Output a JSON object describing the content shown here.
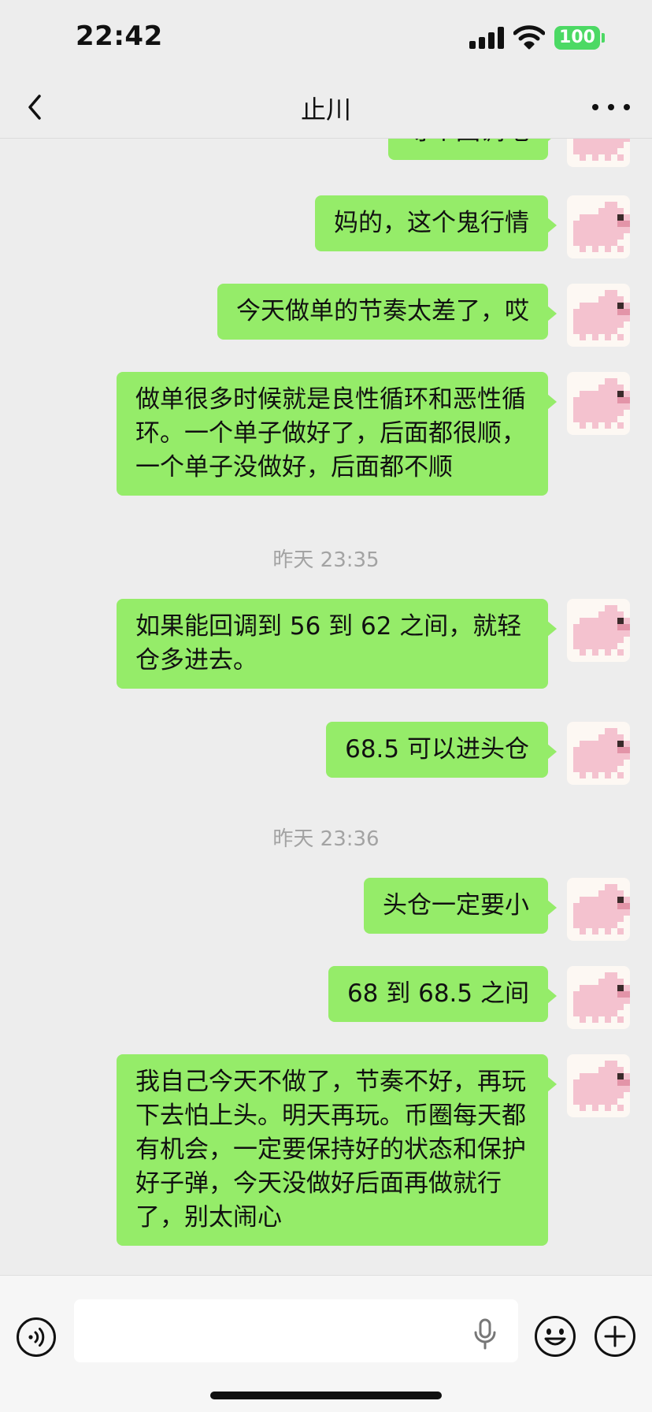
{
  "status_bar": {
    "time": "22:42",
    "battery": "100"
  },
  "header": {
    "title": "止川",
    "back_icon": "chevron-left-icon",
    "more_icon": "more-dots-icon"
  },
  "messages": [
    {
      "text": "等个回调吧",
      "sender": "self"
    },
    {
      "text": "妈的，这个鬼行情",
      "sender": "self"
    },
    {
      "text": "今天做单的节奏太差了，哎",
      "sender": "self"
    },
    {
      "text": "做单很多时候就是良性循环和恶性循环。一个单子做好了，后面都很顺，一个单子没做好，后面都不顺",
      "sender": "self"
    },
    {
      "timestamp": "昨天 23:35"
    },
    {
      "text": "如果能回调到 56 到 62 之间，就轻仓多进去。",
      "sender": "self"
    },
    {
      "text": "68.5 可以进头仓",
      "sender": "self"
    },
    {
      "timestamp": "昨天 23:36"
    },
    {
      "text": "头仓一定要小",
      "sender": "self"
    },
    {
      "text": "68 到 68.5 之间",
      "sender": "self"
    },
    {
      "text": "我自己今天不做了，节奏不好，再玩下去怕上头。明天再玩。币圈每天都有机会，一定要保持好的状态和保护好子弹，今天没做好后面再做就行了，别太闹心",
      "sender": "self"
    }
  ],
  "input_bar": {
    "voice_icon": "voice-icon",
    "mic_icon": "microphone-icon",
    "emoji_icon": "emoji-icon",
    "plus_icon": "plus-icon"
  },
  "colors": {
    "bubble": "#95ec69",
    "background": "#ededed",
    "timestamp": "#a3a3a3"
  }
}
